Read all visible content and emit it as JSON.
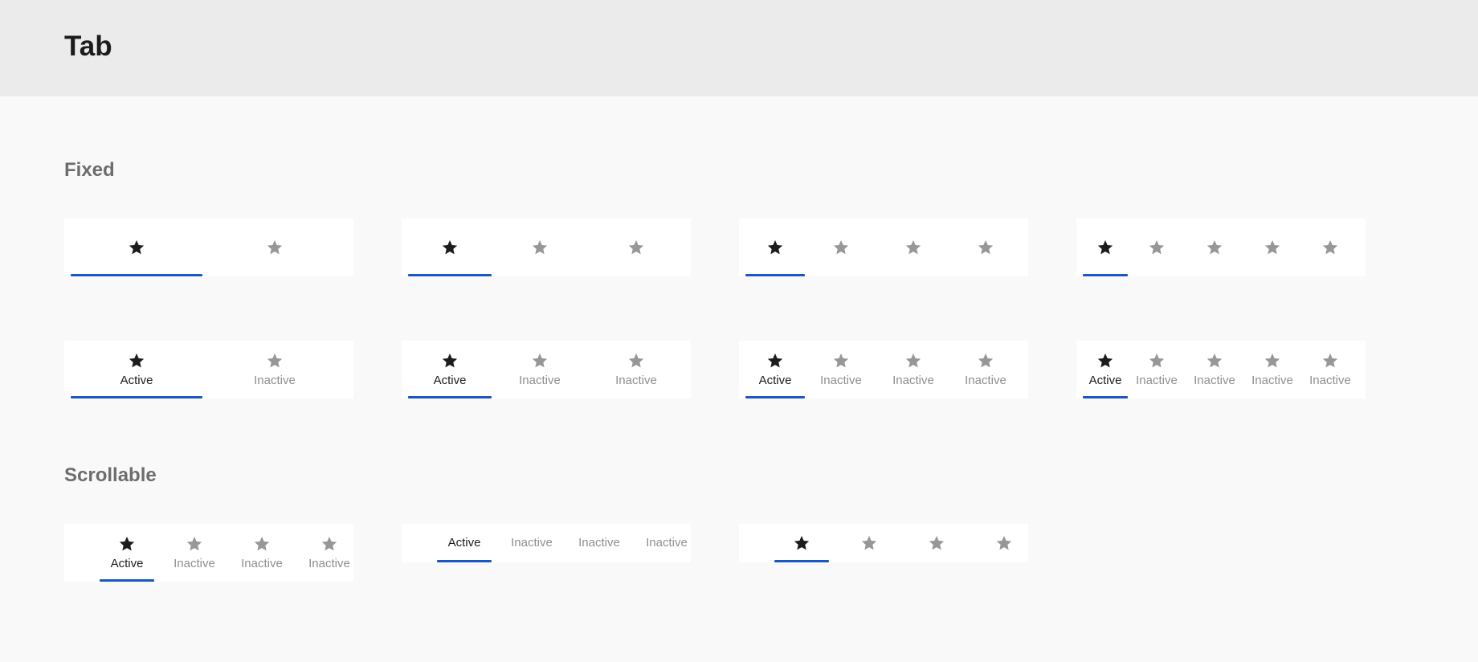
{
  "page": {
    "title": "Tab"
  },
  "sections": {
    "fixed": "Fixed",
    "scrollable": "Scrollable"
  },
  "labels": {
    "active": "Active",
    "inactive": "Inactive"
  },
  "icons": {
    "tab_icon": "star-icon"
  },
  "colors": {
    "indicator": "#1a56c4",
    "active_text": "#1c1c1c",
    "inactive_text": "#8f8f8f",
    "inactive_icon": "#979797"
  },
  "fixed_icon_only_tab_counts": [
    2,
    3,
    4,
    5
  ],
  "fixed_icon_label_tab_counts": [
    2,
    3,
    4,
    5
  ],
  "scrollable_examples": [
    "icon-and-label",
    "label-only",
    "icon-only"
  ]
}
